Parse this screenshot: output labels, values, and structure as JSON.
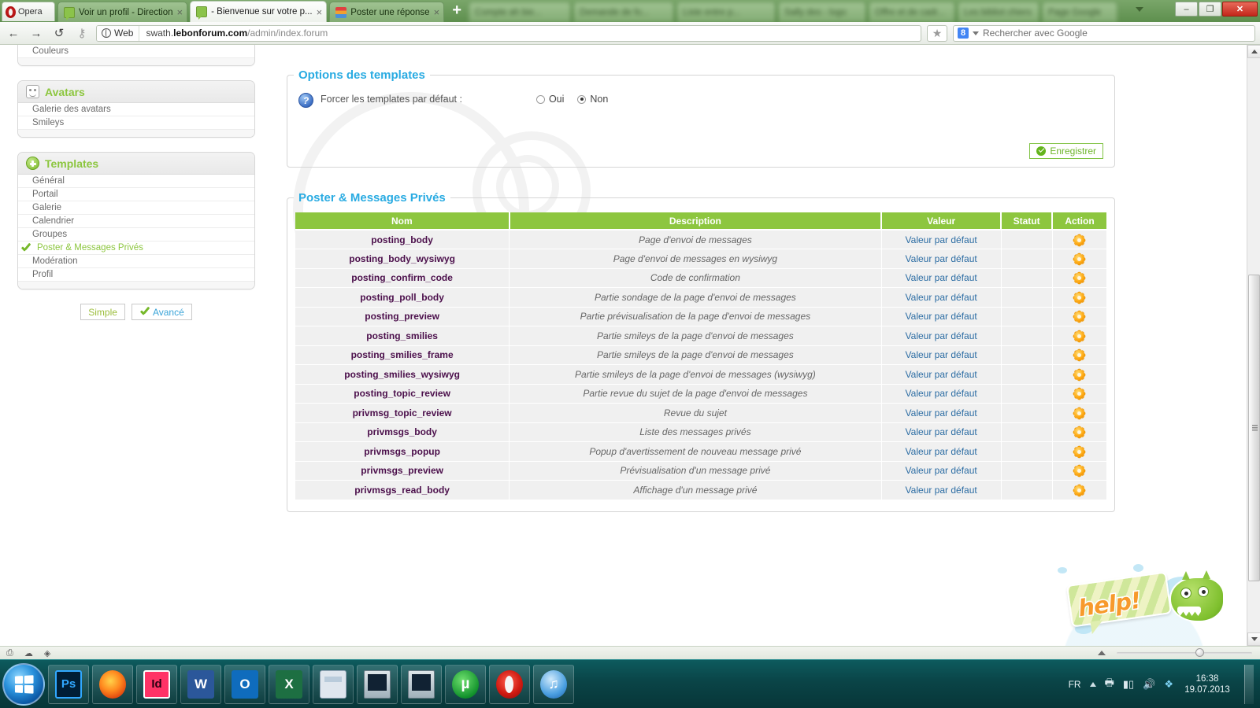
{
  "browser": {
    "app_name": "Opera",
    "tabs": [
      {
        "label": "Voir un profil - Direction",
        "active": false,
        "icon": "green-speech-bubble-icon",
        "blurred": false
      },
      {
        "label": "- Bienvenue sur votre p...",
        "active": true,
        "icon": "green-speech-bubble-icon",
        "blurred": false
      },
      {
        "label": "Poster une réponse",
        "active": false,
        "icon": "stack-icon",
        "blurred": false
      },
      {
        "label": "Compte ah bie...",
        "active": false,
        "icon": "plus-icon",
        "blurred": true
      },
      {
        "label": "Demande de fo...",
        "active": false,
        "icon": "page-icon",
        "blurred": true
      },
      {
        "label": "Liste entre p...",
        "active": false,
        "icon": "page-icon",
        "blurred": true
      },
      {
        "label": "Sally des - logo",
        "active": false,
        "icon": "page-icon",
        "blurred": true
      },
      {
        "label": "Offre et de cadr...",
        "active": false,
        "icon": "page-icon",
        "blurred": true
      },
      {
        "label": "Les bibliot chiers",
        "active": false,
        "icon": "page-icon",
        "blurred": true
      },
      {
        "label": "Page Google",
        "active": false,
        "icon": "page-icon",
        "blurred": true
      }
    ],
    "new_tab_label": "+",
    "tab_close_glyph": "×",
    "window_controls": {
      "minimize": "–",
      "restore": "❐",
      "close": "✕"
    },
    "nav": {
      "back": "←",
      "forward": "→",
      "reload": "↺",
      "key": "⚷",
      "web_label": "Web",
      "url_prefix": "swath.",
      "url_domain": "lebonforum.com",
      "url_path": "/admin/index.forum",
      "star": "★"
    },
    "search": {
      "engine_badge": "8",
      "placeholder": "Rechercher avec Google"
    },
    "status_bar": {
      "icons": [
        "window-icon",
        "cloud-icon",
        "droplet-icon"
      ]
    }
  },
  "sidebar": {
    "partial_block": {
      "items": [
        {
          "label": "Couleurs"
        }
      ]
    },
    "blocks": [
      {
        "title": "Avatars",
        "icon": "avatar-mask-icon",
        "items": [
          {
            "label": "Galerie des avatars",
            "active": false
          },
          {
            "label": "Smileys",
            "active": false
          }
        ]
      },
      {
        "title": "Templates",
        "icon": "plus-circle-icon",
        "items": [
          {
            "label": "Général",
            "active": false
          },
          {
            "label": "Portail",
            "active": false
          },
          {
            "label": "Galerie",
            "active": false
          },
          {
            "label": "Calendrier",
            "active": false
          },
          {
            "label": "Groupes",
            "active": false
          },
          {
            "label": "Poster & Messages Privés",
            "active": true
          },
          {
            "label": "Modération",
            "active": false
          },
          {
            "label": "Profil",
            "active": false
          }
        ]
      }
    ],
    "mode_buttons": {
      "simple": "Simple",
      "advanced": "Avancé"
    }
  },
  "main": {
    "options_panel": {
      "legend": "Options des templates",
      "help_glyph": "?",
      "field_label": "Forcer les templates par défaut :",
      "radios": [
        {
          "label": "Oui",
          "checked": false
        },
        {
          "label": "Non",
          "checked": true
        }
      ],
      "save_label": "Enregistrer"
    },
    "templates_panel": {
      "legend": "Poster & Messages Privés",
      "columns": [
        "Nom",
        "Description",
        "Valeur",
        "Statut",
        "Action"
      ],
      "default_value_label": "Valeur par défaut",
      "action_icon": "gear-icon",
      "rows": [
        {
          "nom": "posting_body",
          "description": "Page d'envoi de messages",
          "valeur": "Valeur par défaut",
          "statut": ""
        },
        {
          "nom": "posting_body_wysiwyg",
          "description": "Page d'envoi de messages en wysiwyg",
          "valeur": "Valeur par défaut",
          "statut": ""
        },
        {
          "nom": "posting_confirm_code",
          "description": "Code de confirmation",
          "valeur": "Valeur par défaut",
          "statut": ""
        },
        {
          "nom": "posting_poll_body",
          "description": "Partie sondage de la page d'envoi de messages",
          "valeur": "Valeur par défaut",
          "statut": ""
        },
        {
          "nom": "posting_preview",
          "description": "Partie prévisualisation de la page d'envoi de messages",
          "valeur": "Valeur par défaut",
          "statut": ""
        },
        {
          "nom": "posting_smilies",
          "description": "Partie smileys de la page d'envoi de messages",
          "valeur": "Valeur par défaut",
          "statut": ""
        },
        {
          "nom": "posting_smilies_frame",
          "description": "Partie smileys de la page d'envoi de messages",
          "valeur": "Valeur par défaut",
          "statut": ""
        },
        {
          "nom": "posting_smilies_wysiwyg",
          "description": "Partie smileys de la page d'envoi de messages (wysiwyg)",
          "valeur": "Valeur par défaut",
          "statut": ""
        },
        {
          "nom": "posting_topic_review",
          "description": "Partie revue du sujet de la page d'envoi de messages",
          "valeur": "Valeur par défaut",
          "statut": ""
        },
        {
          "nom": "privmsg_topic_review",
          "description": "Revue du sujet",
          "valeur": "Valeur par défaut",
          "statut": ""
        },
        {
          "nom": "privmsgs_body",
          "description": "Liste des messages privés",
          "valeur": "Valeur par défaut",
          "statut": ""
        },
        {
          "nom": "privmsgs_popup",
          "description": "Popup d'avertissement de nouveau message privé",
          "valeur": "Valeur par défaut",
          "statut": ""
        },
        {
          "nom": "privmsgs_preview",
          "description": "Prévisualisation d'un message privé",
          "valeur": "Valeur par défaut",
          "statut": ""
        },
        {
          "nom": "privmsgs_read_body",
          "description": "Affichage d'un message privé",
          "valeur": "Valeur par défaut",
          "statut": ""
        }
      ]
    },
    "help_mascot": {
      "word": "help!"
    }
  },
  "taskbar": {
    "start_label": "Démarrer",
    "apps": [
      {
        "name": "photoshop",
        "label": "Ps"
      },
      {
        "name": "firefox",
        "label": ""
      },
      {
        "name": "indesign",
        "label": "Id"
      },
      {
        "name": "word",
        "label": "W"
      },
      {
        "name": "outlook",
        "label": "O"
      },
      {
        "name": "excel",
        "label": "X"
      },
      {
        "name": "calculator",
        "label": ""
      },
      {
        "name": "monitor-app",
        "label": ""
      },
      {
        "name": "monitor-app-2",
        "label": ""
      },
      {
        "name": "utorrent",
        "label": "µ"
      },
      {
        "name": "opera",
        "label": ""
      },
      {
        "name": "itunes",
        "label": "♫"
      }
    ],
    "tray": {
      "language": "FR",
      "icons": [
        "show-hidden-icon",
        "printer-icon",
        "network-icon",
        "volume-icon",
        "dropbox-icon"
      ],
      "time": "16:38",
      "date": "19.07.2013"
    }
  },
  "colors": {
    "accent_green": "#8dc63f",
    "accent_blue": "#29abe2",
    "row_name": "#4b0f4b",
    "link_blue": "#2b6ca3",
    "taskbar": "#0a4447"
  }
}
